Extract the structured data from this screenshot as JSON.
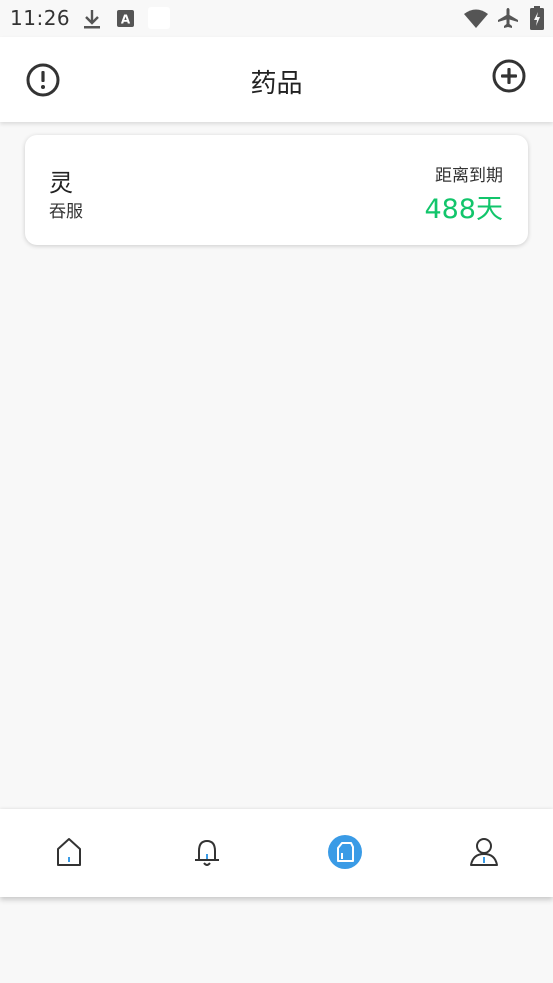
{
  "status_bar": {
    "time": "11:26",
    "icons": [
      "download-icon",
      "a-notification-icon",
      "wifi-icon",
      "airplane-mode-icon",
      "battery-icon"
    ]
  },
  "header": {
    "title": "药品",
    "left_icon": "alert-circle-icon",
    "right_icon": "plus-circle-icon"
  },
  "medicines": [
    {
      "name": "灵",
      "usage": "吞服",
      "expiry_label": "距离到期",
      "expiry_value": "488天",
      "expiry_color": "#12c56b"
    }
  ],
  "tabbar": {
    "items": [
      {
        "icon": "home-icon",
        "active": false
      },
      {
        "icon": "bell-icon",
        "active": false
      },
      {
        "icon": "medicine-bottle-icon",
        "active": true
      },
      {
        "icon": "user-icon",
        "active": false
      }
    ],
    "active_color": "#3a9be6"
  }
}
